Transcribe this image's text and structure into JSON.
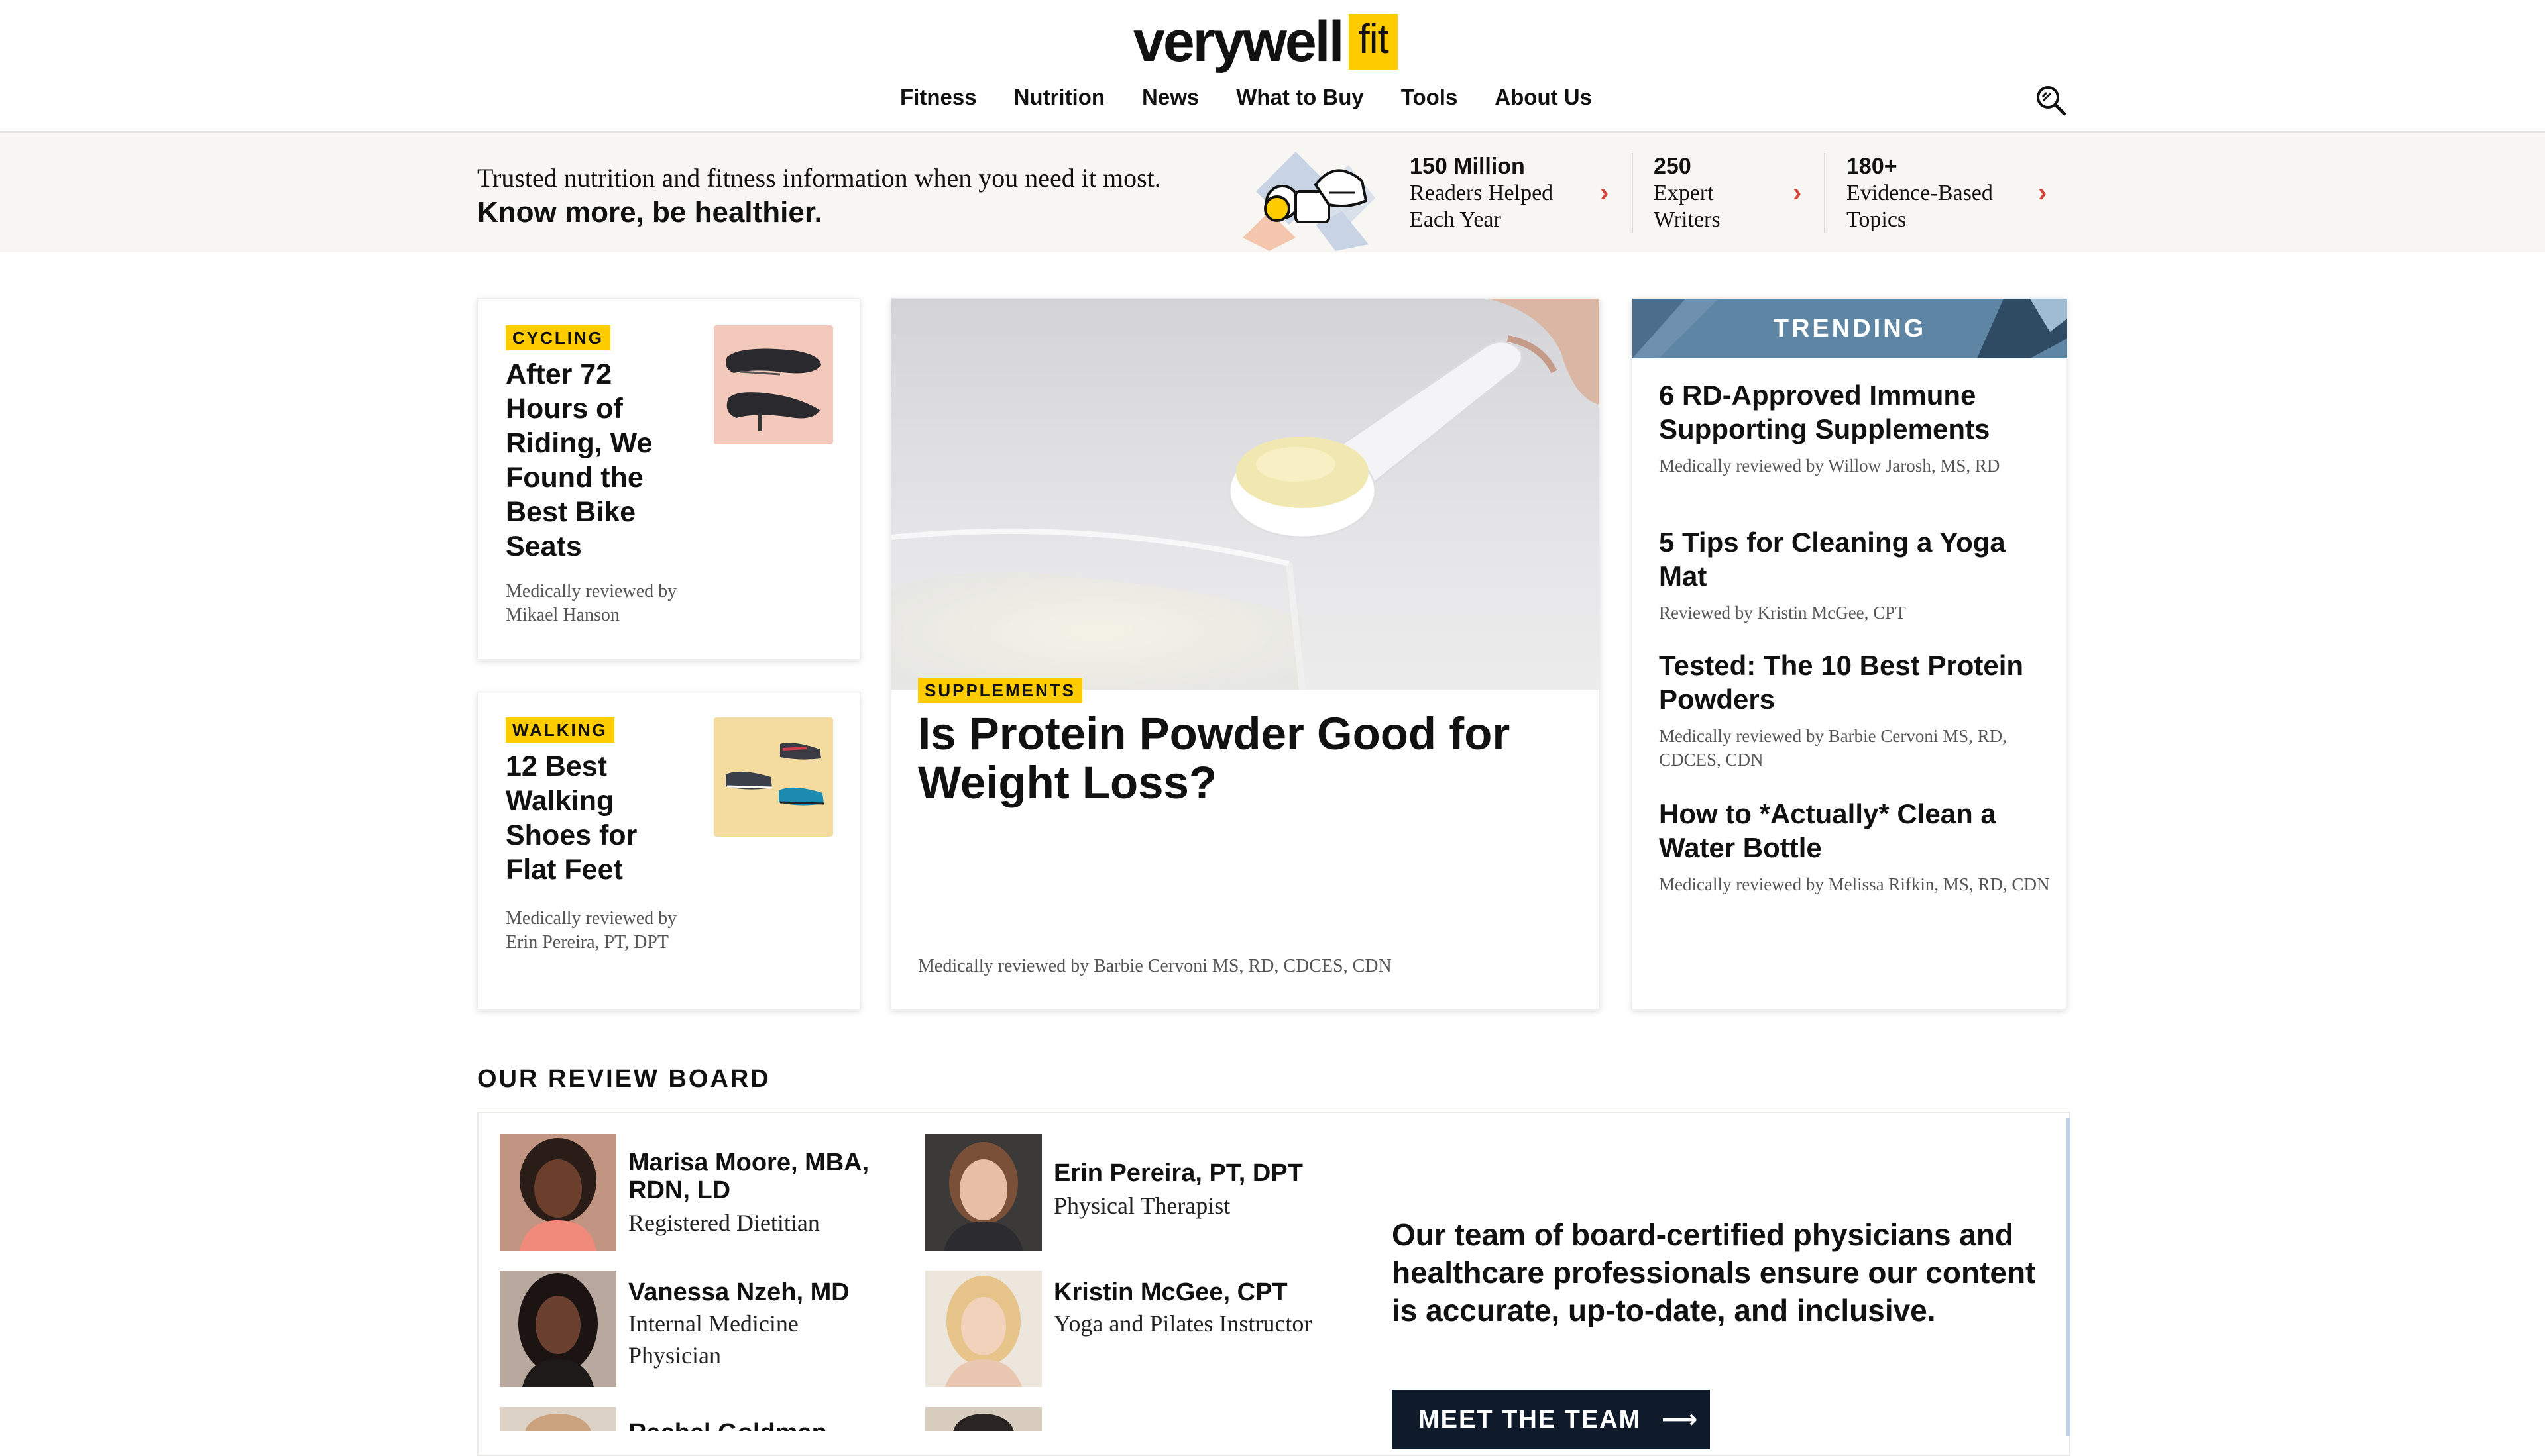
{
  "brand": {
    "name": "verywell",
    "sub": "fit",
    "accent": "#ffcc00"
  },
  "nav": [
    "Fitness",
    "Nutrition",
    "News",
    "What to Buy",
    "Tools",
    "About Us"
  ],
  "banner": {
    "line1": "Trusted nutrition and fitness information when you need it most.",
    "line2": "Know more, be healthier.",
    "stats": [
      {
        "line1": "150 Million",
        "line2": "Readers Helped",
        "line3": "Each Year"
      },
      {
        "line1": "250",
        "line2": "Expert",
        "line3": "Writers"
      },
      {
        "line1": "180+",
        "line2": "Evidence-Based",
        "line3": "Topics"
      }
    ]
  },
  "cards": {
    "cycling": {
      "tag": "CYCLING",
      "title": "After 72 Hours of Riding, We Found the Best Bike Seats",
      "byline": "Medically reviewed by Mikael Hanson"
    },
    "walking": {
      "tag": "WALKING",
      "title": "12 Best Walking Shoes for Flat Feet",
      "byline": "Medically reviewed by Erin Pereira, PT, DPT"
    },
    "hero": {
      "tag": "SUPPLEMENTS",
      "title": "Is Protein Powder Good for Weight Loss?",
      "byline": "Medically reviewed by Barbie Cervoni MS, RD, CDCES, CDN"
    }
  },
  "trending": {
    "label": "TRENDING",
    "items": [
      {
        "title": "6 RD-Approved Immune Supporting Supplements",
        "byline": "Medically reviewed by Willow Jarosh, MS, RD"
      },
      {
        "title": "5 Tips for Cleaning a Yoga Mat",
        "byline": "Reviewed by Kristin McGee, CPT"
      },
      {
        "title": "Tested: The 10 Best Protein Powders",
        "byline": "Medically reviewed by Barbie Cervoni MS, RD, CDCES, CDN"
      },
      {
        "title": "How to *Actually* Clean a Water Bottle",
        "byline": "Medically reviewed by Melissa Rifkin, MS, RD, CDN"
      }
    ]
  },
  "review_board": {
    "heading": "OUR REVIEW BOARD",
    "people": [
      {
        "name": "Marisa Moore, MBA, RDN, LD",
        "role": "Registered Dietitian"
      },
      {
        "name": "Erin Pereira, PT, DPT",
        "role": "Physical Therapist"
      },
      {
        "name": "Vanessa Nzeh, MD",
        "role": "Internal Medicine Physician"
      },
      {
        "name": "Kristin McGee, CPT",
        "role": "Yoga and Pilates Instructor"
      },
      {
        "name": "Rachel Goldman",
        "role": ""
      }
    ],
    "statement": "Our team of board-certified physicians and healthcare professionals ensure our content is accurate, up-to-date, and inclusive.",
    "button": "MEET THE TEAM"
  }
}
